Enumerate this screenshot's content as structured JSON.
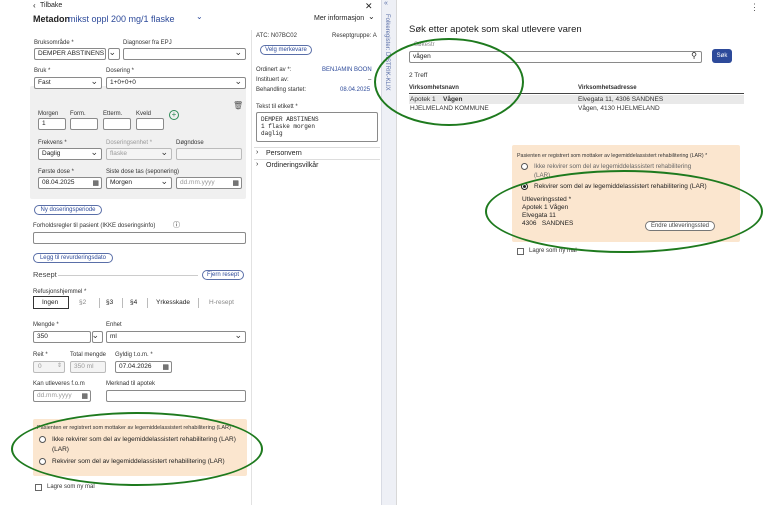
{
  "left": {
    "back_label": "Tilbake",
    "title_drug": "Metadon",
    "title_detail": "mikst oppl 200 mg/1 flaske",
    "more_info": "Mer informasjon",
    "bruksomrade_label": "Bruksområde *",
    "bruksomrade_value": "DEMPER ABSTINENS",
    "diagnose_label": "Diagnoser fra EPJ",
    "bruk_label": "Bruk *",
    "bruk_value": "Fast",
    "dosering_label": "Dosering *",
    "dosering_value": "1+0+0+0",
    "morgen_label": "Morgen",
    "morgen_value": "1",
    "form_label": "Form.",
    "etterm_label": "Etterm.",
    "kveld_label": "Kveld",
    "frekvens_label": "Frekvens *",
    "frekvens_value": "Daglig",
    "doseringsenhet_label": "Doseringsenhet *",
    "doseringsenhet_value": "flaske",
    "dagndose_label": "Døgndose",
    "forste_dose_label": "Første dose *",
    "forste_dose_value": "08.04.2025",
    "siste_dose_label": "Siste dose tas (seponering)",
    "siste_dose_value": "Morgen",
    "siste_dose_date_placeholder": "dd.mm.yyyy",
    "ny_doseringsperiode": "Ny doseringsperiode",
    "forholdsregler_label": "Forholdsregler til pasient (IKKE doseringsinfo)",
    "revurdering_button": "Legg til revurderingsdato",
    "resept_label": "Resept",
    "fjern_resept": "Fjern resept",
    "refusjon_label": "Refusjonshjemmel *",
    "refusjon_options": [
      "Ingen",
      "§2",
      "§3",
      "§4",
      "Yrkesskade",
      "H-resept"
    ],
    "mengde_label": "Mengde *",
    "mengde_value": "350",
    "enhet_label": "Enhet",
    "enhet_value": "ml",
    "reit_label": "Reit *",
    "reit_value": "0",
    "total_mengde_label": "Total mengde",
    "total_mengde_value": "350 ml",
    "gyldig_label": "Gyldig t.o.m. *",
    "gyldig_value": "07.04.2026",
    "kan_utleveres_label": "Kan utleveres f.o.m",
    "kan_utleveres_placeholder": "dd.mm.yyyy",
    "merknad_label": "Merknad til apotek",
    "lar_question": "Pasienten er registrert som mottaker av legemiddelassistert rehabilitering (LAR) *",
    "lar_option_1": "Ikke rekvirer som del av legemiddelassistert rehabilitering (LAR)",
    "lar_option_2": "Rekvirer som del av legemiddelassistert rehabilitering (LAR)",
    "lagre_mal": "Lagre som ny mal",
    "atc_label": "ATC: N07BC02",
    "reseptgruppe_label": "Reseptgruppe: A",
    "velg_merkevare": "Velg merkevare",
    "ordinert_av_label": "Ordinert av *:",
    "ordinert_av_value": "BENJAMIN BOON",
    "instituert_av_label": "Instituert av:",
    "instituert_av_value": "–",
    "behandling_label": "Behandling startet:",
    "behandling_value": "08.04.2025",
    "tekst_etikett_label": "Tekst til etikett *",
    "tekst_etikett_lines": [
      "DEMPER ABSTINENS",
      "1 flaske morgen",
      "daglig"
    ],
    "personvern": "Personvern",
    "ordineringsvilkar": "Ordineringsvilkår",
    "side_tab": "Folkeregister: DISTRIK-KLIX"
  },
  "right": {
    "title": "Søk etter apotek som skal utlevere varen",
    "search_label": "Søkestr",
    "search_value": "vågen",
    "search_button": "Søk",
    "treff": "2 Treff",
    "col_name": "Virksomhetsnavn",
    "col_address": "Virksomhetsadresse",
    "rows": [
      {
        "name_prefix": "Apotek 1 ",
        "name_bold": "Vågen",
        "address": "Elvegata 11, 4306 SANDNES"
      },
      {
        "name_prefix": "HJELMELAND KOMMUNE",
        "name_bold": "",
        "address": "Vågen, 4130 HJELMELAND"
      }
    ],
    "lar_question": "Pasienten er registrert som mottaker av legemiddelassistert rehabilitering (LAR) *",
    "lar_option_1": "Ikke rekvirer som del av legemiddelassistert rehabilitering",
    "lar_option_1_cont": "(LAR)",
    "lar_option_2": "Rekvirer som del av legemiddelassistert rehabilitering (LAR)",
    "utleveringssted_label": "Utleveringssted *",
    "utleveringssted_name": "Apotek 1 Vågen",
    "utleveringssted_street": "Elvegata 11",
    "utleveringssted_postal": "4306   SANDNES",
    "endre_button": "Endre utleveringssted",
    "lagre_mal": "Lagre som ny mal"
  },
  "colors": {
    "accent": "#2d4a9a",
    "lar_background": "#fbe6cf",
    "highlight_ellipse": "#1e7a1e",
    "left_panel_bg": "#f5f5f5"
  }
}
